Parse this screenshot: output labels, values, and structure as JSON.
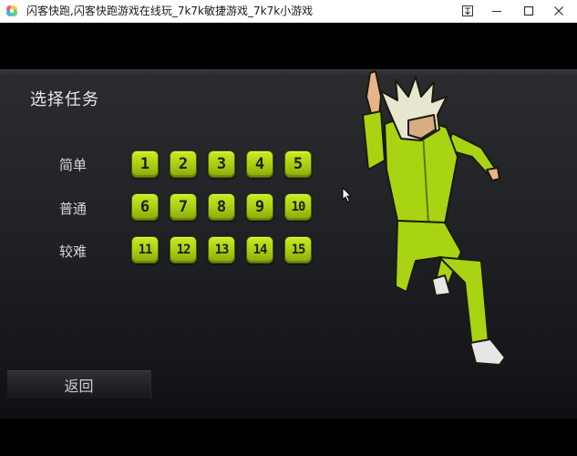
{
  "window": {
    "title": "闪客快跑,闪客快跑游戏在线玩_7k7k敏捷游戏_7k7k小游戏",
    "icon": "app-logo-icon",
    "buttons": [
      "pin-icon",
      "minimize-icon",
      "maximize-icon",
      "close-icon"
    ]
  },
  "game": {
    "screen_title": "选择任务",
    "rows": [
      {
        "label": "简单",
        "levels": [
          "1",
          "2",
          "3",
          "4",
          "5"
        ]
      },
      {
        "label": "普通",
        "levels": [
          "6",
          "7",
          "8",
          "9",
          "10"
        ]
      },
      {
        "label": "较难",
        "levels": [
          "11",
          "12",
          "13",
          "14",
          "15"
        ]
      }
    ],
    "back_label": "返回",
    "level_button_color": "#a6cc12",
    "character": "green-tracksuit-runner"
  }
}
